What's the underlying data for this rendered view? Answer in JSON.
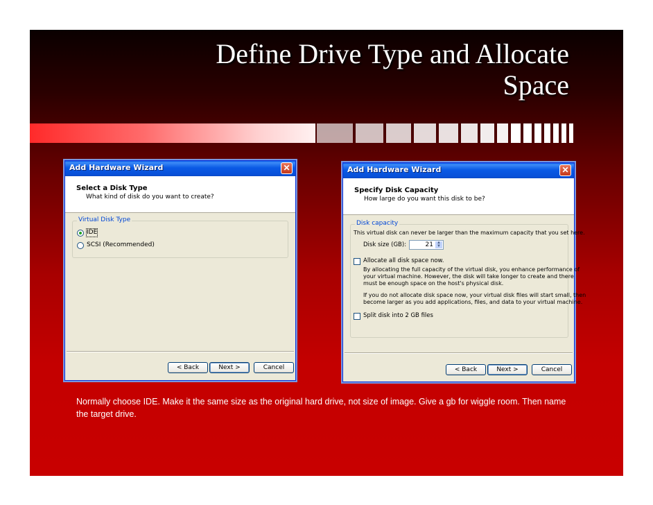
{
  "slide": {
    "title_line1": "Define Drive Type and Allocate",
    "title_line2": "Space",
    "note": "Normally choose IDE.  Make it the same size as the original hard drive, not size of image.  Give a gb for wiggle room.  Then name the target drive."
  },
  "colors": {
    "background_top": "#0a0000",
    "background_bottom": "#c80000",
    "xp_titlebar": "#0a58e8",
    "dialog": "#ece9d8"
  },
  "wizard_left": {
    "window_title": "Add Hardware Wizard",
    "header_title": "Select a Disk Type",
    "header_subtitle": "What kind of disk do you want to create?",
    "group_label": "Virtual Disk Type",
    "options": [
      {
        "label": "IDE",
        "selected": true
      },
      {
        "label": "SCSI  (Recommended)",
        "selected": false
      }
    ],
    "buttons": {
      "back": "< Back",
      "next": "Next >",
      "cancel": "Cancel"
    }
  },
  "wizard_right": {
    "window_title": "Add Hardware Wizard",
    "header_title": "Specify Disk Capacity",
    "header_subtitle": "How large do you want this disk to be?",
    "group_label": "Disk capacity",
    "capacity_note": "This virtual disk can never be larger than the maximum capacity that you set here.",
    "disk_size_label": "Disk size (GB):",
    "disk_size_value": "21",
    "allocate_label": "Allocate all disk space now.",
    "allocate_checked": false,
    "allocate_desc_1": "By allocating the full capacity of the virtual disk, you enhance performance of",
    "allocate_desc_2": "your virtual machine.  However, the disk will take longer to create and there",
    "allocate_desc_3": "must be enough space on the host's physical disk.",
    "grow_desc_1": "If you do not allocate disk space now, your virtual disk files will start small, then",
    "grow_desc_2": "become larger as you add applications, files, and data to your virtual machine.",
    "split_label": "Split disk into 2 GB files",
    "split_checked": false,
    "buttons": {
      "back": "< Back",
      "next": "Next >",
      "cancel": "Cancel"
    }
  }
}
